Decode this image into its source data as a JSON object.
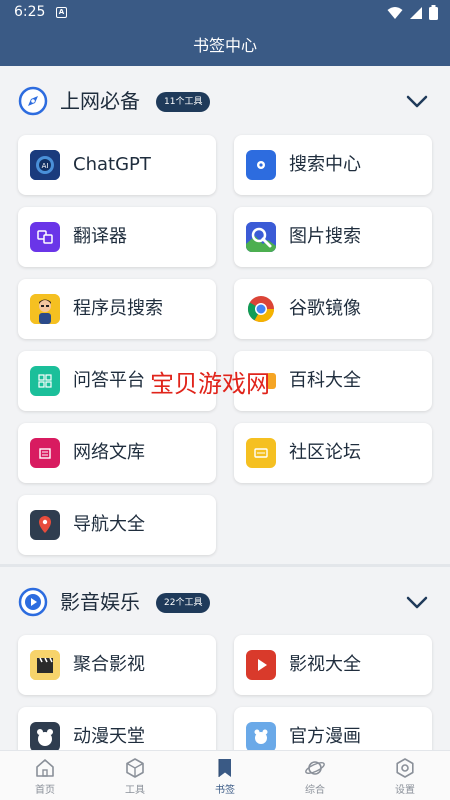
{
  "status_bar": {
    "time": "6:25",
    "notification_letter": "A"
  },
  "app_bar": {
    "title": "书签中心"
  },
  "sections": [
    {
      "title": "上网必备",
      "badge": "11个工具",
      "items": [
        {
          "label": "ChatGPT"
        },
        {
          "label": "搜索中心"
        },
        {
          "label": "翻译器"
        },
        {
          "label": "图片搜索"
        },
        {
          "label": "程序员搜索"
        },
        {
          "label": "谷歌镜像"
        },
        {
          "label": "问答平台"
        },
        {
          "label": "百科大全"
        },
        {
          "label": "网络文库"
        },
        {
          "label": "社区论坛"
        },
        {
          "label": "导航大全"
        }
      ]
    },
    {
      "title": "影音娱乐",
      "badge": "22个工具",
      "items": [
        {
          "label": "聚合影视"
        },
        {
          "label": "影视大全"
        },
        {
          "label": "动漫天堂"
        },
        {
          "label": "官方漫画"
        }
      ]
    }
  ],
  "watermark": "宝贝游戏网",
  "bottom_nav": [
    {
      "label": "首页",
      "icon": "home-icon"
    },
    {
      "label": "工具",
      "icon": "cube-icon"
    },
    {
      "label": "书签",
      "icon": "bookmark-icon",
      "active": true
    },
    {
      "label": "综合",
      "icon": "planet-icon"
    },
    {
      "label": "设置",
      "icon": "settings-icon"
    }
  ],
  "colors": {
    "primary": "#3a5a85",
    "badge": "#1f3a5a",
    "background": "#f2f3f5",
    "watermark": "#e0241b"
  }
}
